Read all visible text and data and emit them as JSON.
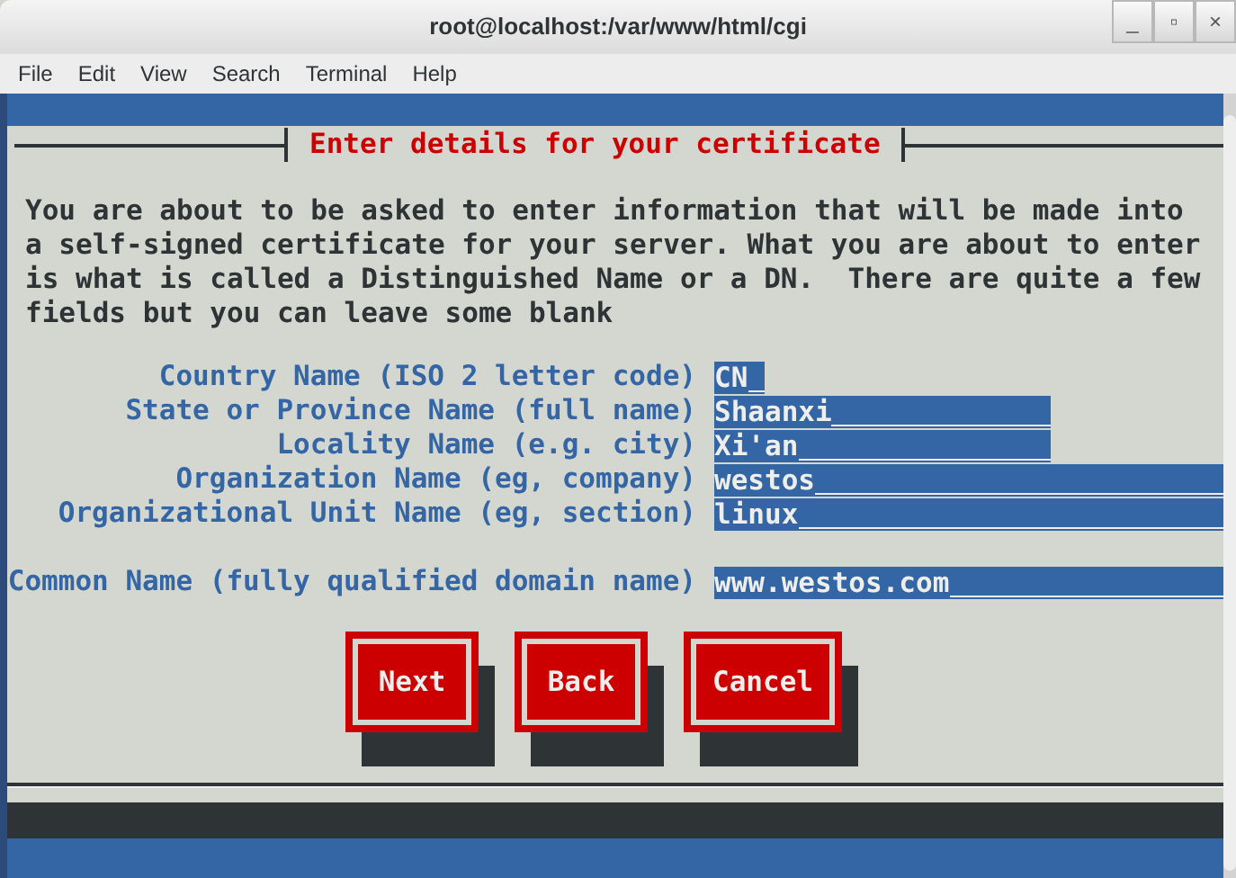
{
  "window": {
    "title": "root@localhost:/var/www/html/cgi",
    "controls": [
      "_",
      "▫",
      "×"
    ]
  },
  "menu": [
    "File",
    "Edit",
    "View",
    "Search",
    "Terminal",
    "Help"
  ],
  "dialog": {
    "title": "Enter details for your certificate",
    "intro": "You are about to be asked to enter information that will be made into a self-signed certificate for your server. What you are about to enter is what is called a Distinguished Name or a DN.  There are quite a few fields but you can leave some blank",
    "fields": [
      {
        "label": "Country Name (ISO 2 letter code)",
        "value": "CN"
      },
      {
        "label": "State or Province Name (full name)",
        "value": "Shaanxi"
      },
      {
        "label": "Locality Name (e.g. city)",
        "value": "Xi'an"
      },
      {
        "label": "Organization Name (eg, company)",
        "value": "westos"
      },
      {
        "label": "Organizational Unit Name (eg, section)",
        "value": "linux"
      },
      {
        "label": "Common Name (fully qualified domain name)",
        "value": "www.westos.com"
      }
    ],
    "buttons": [
      "Next",
      "Back",
      "Cancel"
    ]
  }
}
